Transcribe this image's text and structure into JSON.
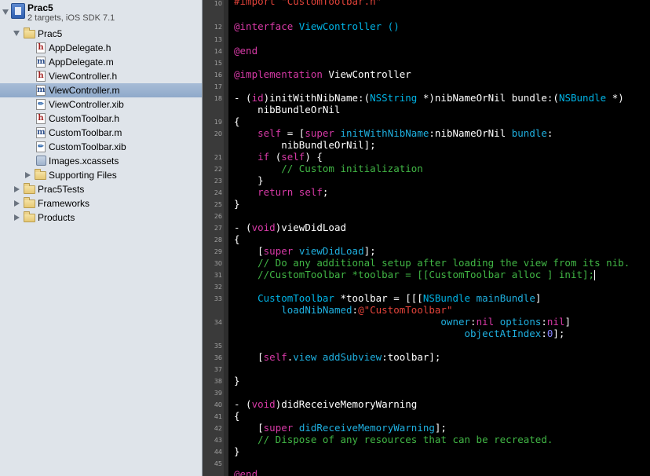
{
  "navigator": {
    "project": {
      "name": "Prac5",
      "subtitle": "2 targets, iOS SDK 7.1"
    },
    "items": [
      {
        "label": "Prac5",
        "kind": "folder",
        "expanded": true,
        "depth": 1
      },
      {
        "label": "AppDelegate.h",
        "kind": "h",
        "depth": 2
      },
      {
        "label": "AppDelegate.m",
        "kind": "m",
        "depth": 2
      },
      {
        "label": "ViewController.h",
        "kind": "h",
        "depth": 2
      },
      {
        "label": "ViewController.m",
        "kind": "m",
        "depth": 2,
        "selected": true
      },
      {
        "label": "ViewController.xib",
        "kind": "xib",
        "depth": 2
      },
      {
        "label": "CustomToolbar.h",
        "kind": "h",
        "depth": 2
      },
      {
        "label": "CustomToolbar.m",
        "kind": "m",
        "depth": 2
      },
      {
        "label": "CustomToolbar.xib",
        "kind": "xib",
        "depth": 2
      },
      {
        "label": "Images.xcassets",
        "kind": "assets",
        "depth": 2
      },
      {
        "label": "Supporting Files",
        "kind": "folder",
        "expanded": false,
        "depth": 2
      },
      {
        "label": "Prac5Tests",
        "kind": "folder",
        "expanded": false,
        "depth": 1
      },
      {
        "label": "Frameworks",
        "kind": "folder",
        "expanded": false,
        "depth": 1
      },
      {
        "label": "Products",
        "kind": "folder",
        "expanded": false,
        "depth": 1
      }
    ],
    "icons": {
      "h": "h",
      "m": "m"
    }
  },
  "editor": {
    "line_numbers": [
      "10",
      "12",
      "13",
      "14",
      "15",
      "16",
      "17",
      "18",
      "19",
      "20",
      "21",
      "22",
      "23",
      "24",
      "25",
      "26",
      "27",
      "28",
      "29",
      "30",
      "31",
      "32",
      "33",
      "34",
      "35",
      "36",
      "37",
      "38",
      "39",
      "40",
      "41",
      "42",
      "43",
      "44",
      "45"
    ],
    "colors": {
      "keyword": "#d83aa7",
      "class": "#00b4e6",
      "comment": "#41b645",
      "string": "#e2433a",
      "number": "#8a86ff"
    },
    "code": {
      "import": "#import \"CustomToolbar.h\"",
      "interface_kw": "@interface",
      "interface_name": " ViewController ()",
      "end1": "@end",
      "impl_kw": "@implementation",
      "impl_name": " ViewController",
      "l18_a": "- (",
      "l18_id": "id",
      "l18_b": ")initWithNibName:(",
      "l18_nsstring": "NSString",
      "l18_c": " *)nibNameOrNil bundle:(",
      "l18_nsbundle": "NSBundle",
      "l18_d": " *)",
      "l18_e": "    nibBundleOrNil",
      "brace_open": "{",
      "l20_indent": "    ",
      "self": "self",
      "l20_b": " = [",
      "super": "super",
      "l20_init": "initWithNibName",
      "l20_c": ":nibNameOrNil ",
      "l20_bundle": "bundle",
      "l20_d": ":",
      "l20_e": "        nibBundleOrNil];",
      "if": "if",
      "l21_b": " (",
      "l21_c": ") {",
      "l22": "        // Custom initialization",
      "l23": "    }",
      "return": "return",
      "semicolon": ";",
      "brace_close": "}",
      "void": "void",
      "l27_b": ")viewDidLoad",
      "l29_a": "    [",
      "viewDidLoad": "viewDidLoad",
      "l29_b": "];",
      "l30": "    // Do any additional setup after loading the view from its nib.",
      "l31": "    //CustomToolbar *toolbar = [[CustomToolbar alloc ] init];",
      "l33_a": "    ",
      "customtoolbar": "CustomToolbar",
      "l33_b": " *toolbar = [[[",
      "nsbundle": "NSBundle",
      "mainbundle": "mainBundle",
      "l33_c": "]",
      "l33_d": "        ",
      "loadnib": "loadNibNamed",
      "l33_e": ":",
      "l33_str": "@\"CustomToolbar\"",
      "l34_a": "                                   ",
      "owner": "owner",
      "nil": "nil",
      "options": "options",
      "l34_b": "]",
      "l34_c": "                                       ",
      "objatindex": "objectAtIndex",
      "zero": "0",
      "l34_d": "];",
      "l36_a": "    [",
      "view": "view",
      "addsubview": "addSubview",
      "l36_b": ":toolbar];",
      "l40_b": ")didReceiveMemoryWarning",
      "didreceive": "didReceiveMemoryWarning",
      "l44": "    // Dispose of any resources that can be recreated.",
      "dot": "."
    }
  }
}
